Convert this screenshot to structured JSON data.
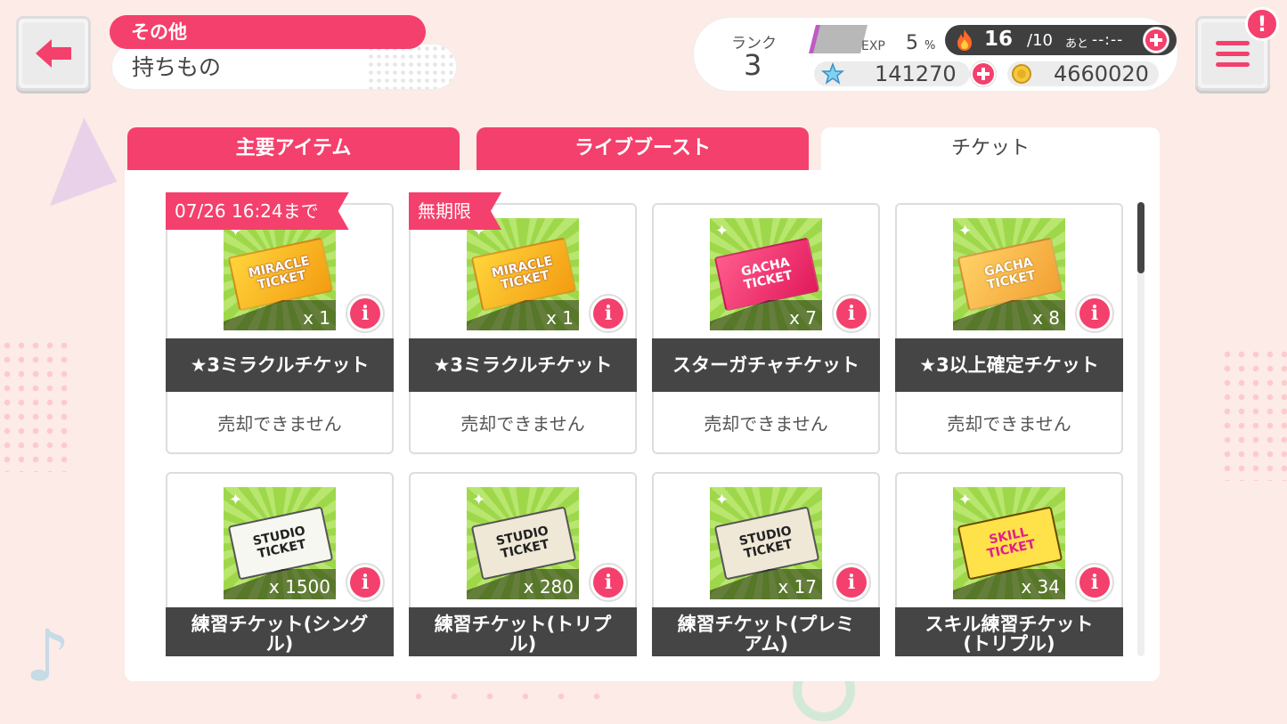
{
  "header": {
    "category": "その他",
    "title": "持ちもの",
    "notification_badge": "!"
  },
  "status": {
    "rank_label": "ランク",
    "rank_value": "3",
    "exp_label": "EXP",
    "exp_percent": "5",
    "exp_percent_unit": "%",
    "stamina_current": "16",
    "stamina_max": "/10",
    "stamina_ato": "あと",
    "stamina_time": "--:--",
    "star_gems": "141270",
    "coins": "4660020"
  },
  "tabs": [
    {
      "label": "主要アイテム",
      "active": false
    },
    {
      "label": "ライブブースト",
      "active": false
    },
    {
      "label": "チケット",
      "active": true
    }
  ],
  "items": [
    {
      "ribbon": "07/26 16:24まで",
      "ticket_text": "MIRACLE\nTICKET",
      "ticket_style": "gold",
      "qty": "x 1",
      "name": "★3ミラクルチケット",
      "sell": "売却できません"
    },
    {
      "ribbon": "無期限",
      "ticket_text": "MIRACLE\nTICKET",
      "ticket_style": "gold",
      "qty": "x 1",
      "name": "★3ミラクルチケット",
      "sell": "売却できません"
    },
    {
      "ribbon": "",
      "ticket_text": "GACHA\nTICKET",
      "ticket_style": "pink",
      "qty": "x 7",
      "name": "スターガチャチケット",
      "sell": "売却できません"
    },
    {
      "ribbon": "",
      "ticket_text": "GACHA\nTICKET",
      "ticket_style": "orange",
      "qty": "x 8",
      "name": "★3以上確定チケット",
      "sell": "売却できません"
    },
    {
      "ribbon": "",
      "ticket_text": "STUDIO\nTICKET",
      "ticket_style": "white",
      "qty": "x 1500",
      "name": "練習チケット(シングル)",
      "sell": ""
    },
    {
      "ribbon": "",
      "ticket_text": "STUDIO\nTICKET",
      "ticket_style": "beige",
      "qty": "x 280",
      "name": "練習チケット(トリプル)",
      "sell": ""
    },
    {
      "ribbon": "",
      "ticket_text": "STUDIO\nTICKET",
      "ticket_style": "beige",
      "qty": "x 17",
      "name": "練習チケット(プレミアム)",
      "sell": ""
    },
    {
      "ribbon": "",
      "ticket_text": "SKILL\nTICKET",
      "ticket_style": "yellow",
      "qty": "x 34",
      "name": "スキル練習チケット(トリプル)",
      "sell": ""
    }
  ],
  "icons": {
    "back": "back-arrow-icon",
    "menu": "hamburger-menu-icon",
    "stamina": "flame-icon",
    "gem": "star-gem-icon",
    "coin": "coin-icon",
    "info": "info-icon"
  },
  "colors": {
    "accent": "#f4406c",
    "dark": "#454545",
    "background": "#fcebe6"
  }
}
